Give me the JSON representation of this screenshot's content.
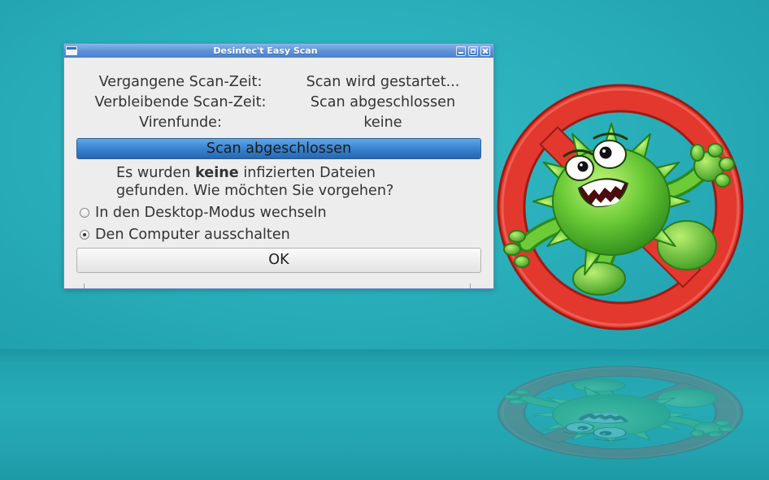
{
  "window": {
    "title": "Desinfec't Easy Scan",
    "controls": {
      "menu_icon": "window-icon",
      "minimize_icon": "minimize-icon",
      "maximize_icon": "maximize-icon",
      "close_icon": "close-icon"
    }
  },
  "scan_status": [
    {
      "label": "Vergangene Scan-Zeit:",
      "value": "Scan wird gestartet..."
    },
    {
      "label": "Verbleibende Scan-Zeit:",
      "value": "Scan abgeschlossen"
    },
    {
      "label": "Virenfunde:",
      "value": "keine"
    }
  ],
  "progress": {
    "text": "Scan abgeschlossen",
    "fraction": 1.0
  },
  "message": {
    "line1_prefix": "Es wurden ",
    "line1_emphasis": "keine",
    "line1_suffix": " infizierten Dateien",
    "line2": "gefunden. Wie möchten Sie vorgehen?"
  },
  "options": [
    {
      "label": "In den Desktop-Modus wechseln",
      "selected": false
    },
    {
      "label": "Den Computer ausschalten",
      "selected": true
    }
  ],
  "ok_button": {
    "label": "OK"
  },
  "desktop": {
    "artwork_icon": "virus-prohibition-icon"
  },
  "colors": {
    "titlebar": "#5f93d8",
    "window_background": "#ededed",
    "text": "#333333",
    "progress_fill": "#3c87d2",
    "desktop_background": "#27adb8",
    "prohibition_red": "#e3382e",
    "virus_green": "#6ccb37"
  }
}
